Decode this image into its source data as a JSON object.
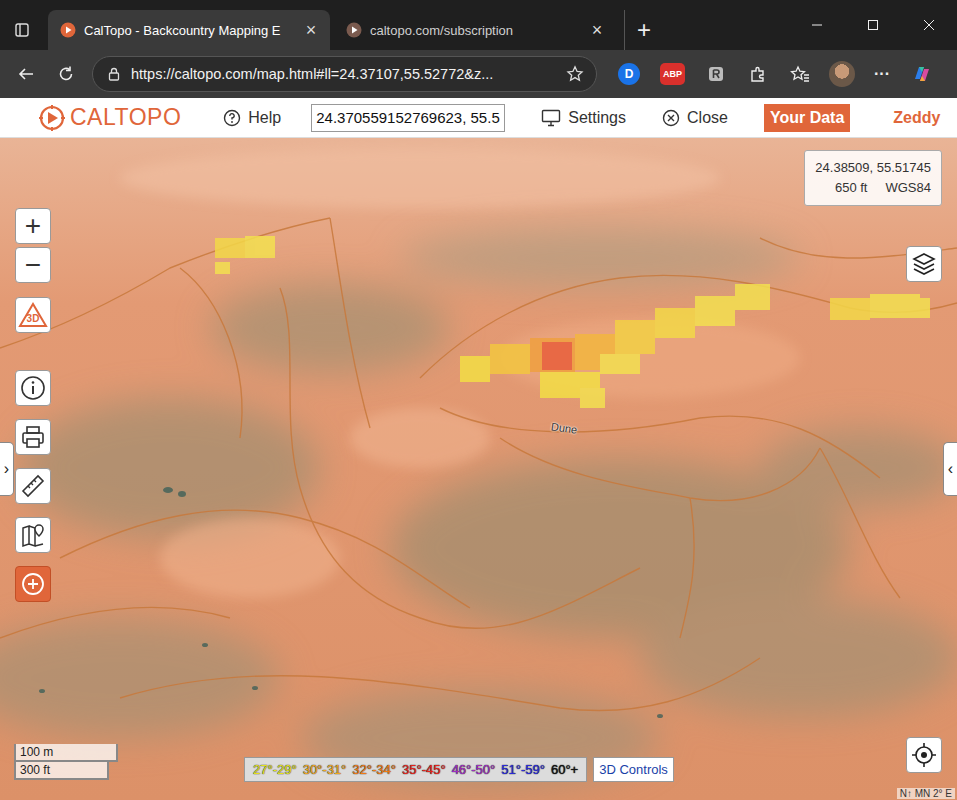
{
  "browser": {
    "tabs": [
      {
        "label": "CalTopo - Backcountry Mapping E",
        "selected": true,
        "close": "×"
      },
      {
        "label": "caltopo.com/subscription",
        "selected": false,
        "close": "×"
      }
    ],
    "new_tab": "+",
    "url": "https://caltopo.com/map.html#ll=24.37107,55.52772&z...",
    "extensions": [
      {
        "label": "D",
        "color": "#1a73e8"
      },
      {
        "label": "ABP",
        "color": "#d9302c"
      }
    ],
    "more": "···"
  },
  "app": {
    "logo": "CALTOPO",
    "help": "Help",
    "search": "24.370559152769623, 55.5",
    "settings": "Settings",
    "close": "Close",
    "your_data": "Your Data",
    "user": "Zeddy"
  },
  "map": {
    "zoom_in": "+",
    "zoom_out": "−",
    "mode_3d": "3D",
    "left_toggle": "›",
    "right_toggle": "‹",
    "label": "Dune",
    "cursor": {
      "coords": "24.38509, 55.51745",
      "elevation": "650 ft",
      "datum": "WGS84"
    },
    "scale": {
      "metric": "100 m",
      "imperial": "300 ft"
    },
    "legend": [
      {
        "label": "27°-29°",
        "color": "#e6e21a"
      },
      {
        "label": "30°-31°",
        "color": "#f2a81c"
      },
      {
        "label": "32°-34°",
        "color": "#f07a12"
      },
      {
        "label": "35°-45°",
        "color": "#e5231b"
      },
      {
        "label": "46°-50°",
        "color": "#a12cc0"
      },
      {
        "label": "51°-59°",
        "color": "#2a2ad8"
      },
      {
        "label": "60°+",
        "color": "#111111"
      }
    ],
    "controls_3d": "3D Controls",
    "north": "N↑ MN 2° E"
  }
}
